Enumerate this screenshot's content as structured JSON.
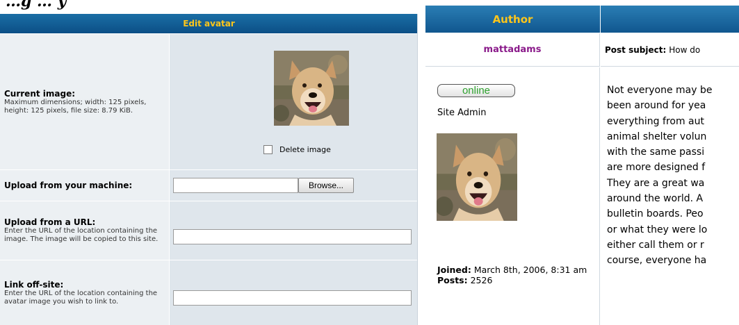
{
  "top_heading": "…g … y",
  "edit_avatar": {
    "header": "Edit avatar",
    "current_image": {
      "title": "Current image:",
      "description": "Maximum dimensions; width: 125 pixels, height: 125 pixels, file size: 8.79 KiB."
    },
    "delete_image_label": "Delete image",
    "upload_machine": {
      "title": "Upload from your machine:",
      "browse_label": "Browse..."
    },
    "upload_url": {
      "title": "Upload from a URL:",
      "description": "Enter the URL of the location containing the image. The image will be copied to this site.",
      "value": ""
    },
    "link_offsite": {
      "title": "Link off-site:",
      "description": "Enter the URL of the location containing the avatar image you wish to link to.",
      "value": ""
    }
  },
  "post": {
    "header_author": "Author",
    "author_name": "mattadams",
    "subject_label": "Post subject:",
    "subject_value": "How do",
    "online_badge": "online",
    "rank": "Site Admin",
    "joined_label": "Joined:",
    "joined_value": "March 8th, 2006, 8:31 am",
    "posts_label": "Posts:",
    "posts_value": "2526",
    "message_lines": [
      "Not everyone may be",
      "been around for yea",
      "everything from aut",
      "animal shelter volun",
      "with the same passi",
      "are more designed f",
      "They are a great wa",
      "around the world. A",
      "bulletin boards. Peo",
      "or what they were lo",
      "either call them or r",
      "course, everyone ha"
    ]
  },
  "colors": {
    "header_blue": "#0c4f86",
    "header_text_gold": "#ffc61a",
    "author_purple": "#8a1a8a",
    "online_green": "#2ea12e"
  }
}
